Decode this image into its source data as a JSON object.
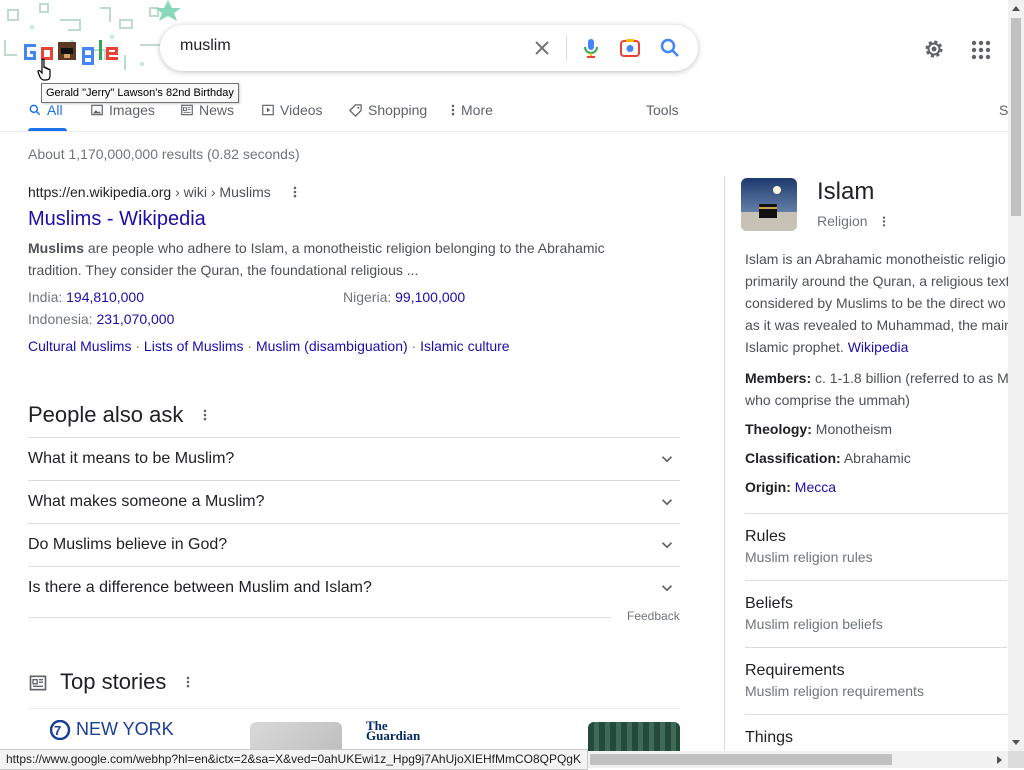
{
  "doodle": {
    "tooltip": "Gerald \"Jerry\" Lawson's 82nd Birthday"
  },
  "search": {
    "query": "muslim"
  },
  "tabs": [
    {
      "label": "All",
      "icon": "search-icon"
    },
    {
      "label": "Images",
      "icon": "image-icon"
    },
    {
      "label": "News",
      "icon": "news-icon"
    },
    {
      "label": "Videos",
      "icon": "video-icon"
    },
    {
      "label": "Shopping",
      "icon": "tag-icon"
    },
    {
      "label": "More",
      "icon": "more-vert-icon"
    }
  ],
  "tools_label": "Tools",
  "partial_right_tab": "S",
  "stats": "About 1,170,000,000 results (0.82 seconds)",
  "result": {
    "url_domain": "https://en.wikipedia.org",
    "url_crumbs": " › wiki › Muslims",
    "title": "Muslims - Wikipedia",
    "snippet_bold": "Muslims",
    "snippet_rest": " are people who adhere to Islam, a monotheistic religion belonging to the Abrahamic tradition. They consider the Quran, the foundational religious ...",
    "facts": [
      {
        "label": "India: ",
        "value": "194,810,000"
      },
      {
        "label": "Nigeria: ",
        "value": "99,100,000"
      },
      {
        "label": "Indonesia: ",
        "value": "231,070,000"
      }
    ],
    "sitelinks": [
      "Cultural Muslims",
      "Lists of Muslims",
      "Muslim (disambiguation)",
      "Islamic culture"
    ],
    "sitelink_sep": " · "
  },
  "paa": {
    "title": "People also ask",
    "questions": [
      "What it means to be Muslim?",
      "What makes someone a Muslim?",
      "Do Muslims believe in God?",
      "Is there a difference between Muslim and Islam?"
    ],
    "feedback": "Feedback"
  },
  "top_stories": {
    "title": "Top stories",
    "source1": "NEW YORK",
    "source2_line1": "The",
    "source2_line2": "Guardian"
  },
  "knowledge_panel": {
    "title": "Islam",
    "subtitle": "Religion",
    "desc_lines": [
      "Islam is an Abrahamic monotheistic religio",
      "primarily around the Quran, a religious text",
      "considered by Muslims to be the direct wo",
      "as it was revealed to Muhammad, the main",
      "Islamic prophet. "
    ],
    "desc_link": "Wikipedia",
    "members_label": "Members:",
    "members_line1": " c. 1-1.8 billion (referred to as M",
    "members_line2": "who comprise the ummah)",
    "theology_label": "Theology:",
    "theology_value": " Monotheism",
    "classification_label": "Classification:",
    "classification_value": " Abrahamic",
    "origin_label": "Origin:",
    "origin_value": "Mecca",
    "sections": [
      {
        "title": "Rules",
        "sub": "Muslim religion rules"
      },
      {
        "title": "Beliefs",
        "sub": "Muslim religion beliefs"
      },
      {
        "title": "Requirements",
        "sub": "Muslim religion requirements"
      },
      {
        "title": "Things",
        "sub": ""
      }
    ]
  },
  "status_url": "https://www.google.com/webhp?hl=en&ictx=2&sa=X&ved=0ahUKEwi1z_Hpg9j7AhUjoXIEHfMmCO8QPQgK",
  "colors": {
    "link": "#1a0dab",
    "accent": "#1a73e8"
  }
}
